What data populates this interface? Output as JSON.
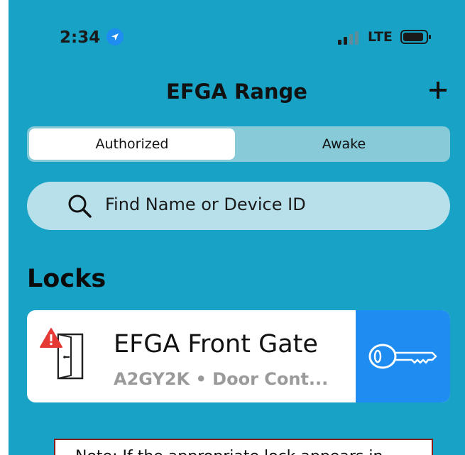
{
  "status_bar": {
    "time": "2:34",
    "network": "LTE",
    "icons": [
      "location-arrow-icon",
      "signal-icon",
      "battery-icon"
    ]
  },
  "nav": {
    "title": "EFGA Range",
    "add_icon": "plus-icon"
  },
  "segments": {
    "tabs": [
      "Authorized",
      "Awake"
    ],
    "selected": "Authorized"
  },
  "search": {
    "placeholder": "Find Name or Device ID",
    "icon": "search-icon"
  },
  "section": {
    "title": "Locks"
  },
  "locks": [
    {
      "name": "EFGA Front Gate",
      "subtitle": "A2GY2K • Door Cont...",
      "icon": "door-icon",
      "status_icon": "warning-icon",
      "action_icon": "key-icon"
    }
  ],
  "note": {
    "text": "Note: If the appropriate lock appears in"
  },
  "colors": {
    "background": "#17a2c6",
    "segment_bg": "#88cad8",
    "search_bg": "#b8e0ea",
    "key_button": "#1e8cf0",
    "warning": "#e53935",
    "subtitle": "#9a9a9a",
    "note_border": "#8a1c1c"
  }
}
